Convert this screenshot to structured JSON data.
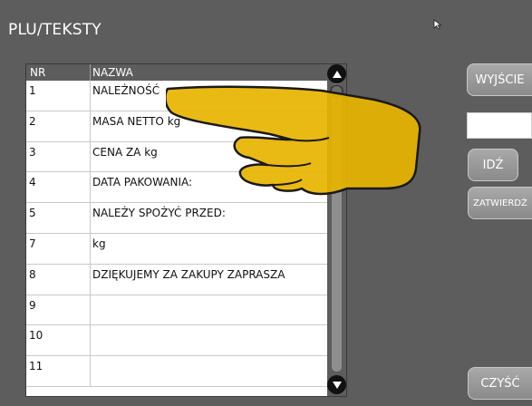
{
  "window": {
    "title": "PLU/TEKSTY"
  },
  "table": {
    "columns": {
      "nr": "NR",
      "name": "NAZWA"
    },
    "rows": [
      {
        "nr": "1",
        "name": "NALEŻNOŚĆ"
      },
      {
        "nr": "2",
        "name": "MASA NETTO kg"
      },
      {
        "nr": "3",
        "name": "CENA ZA  kg"
      },
      {
        "nr": "4",
        "name": "DATA PAKOWANIA:"
      },
      {
        "nr": "5",
        "name": "NALEŻY SPOŻYĆ PRZED:"
      },
      {
        "nr": "7",
        "name": "kg"
      },
      {
        "nr": "8",
        "name": "DZIĘKUJEMY ZA ZAKUPY ZAPRASZA"
      },
      {
        "nr": "9",
        "name": ""
      },
      {
        "nr": "10",
        "name": ""
      },
      {
        "nr": "11",
        "name": ""
      }
    ]
  },
  "buttons": {
    "exit": "WYJŚCIE",
    "go": "IDŹ",
    "confirm": "ZATWIERDŹ",
    "clear": "CZYŚĆ"
  },
  "input": {
    "value": ""
  },
  "icons": {
    "scroll_up": "scroll-up-icon",
    "scroll_down": "scroll-down-icon",
    "pointer_hand": "pointing-hand-icon",
    "mouse_cursor": "mouse-cursor-icon"
  },
  "colors": {
    "background": "#5d5d5d",
    "hand_fill": "#e8b400"
  }
}
